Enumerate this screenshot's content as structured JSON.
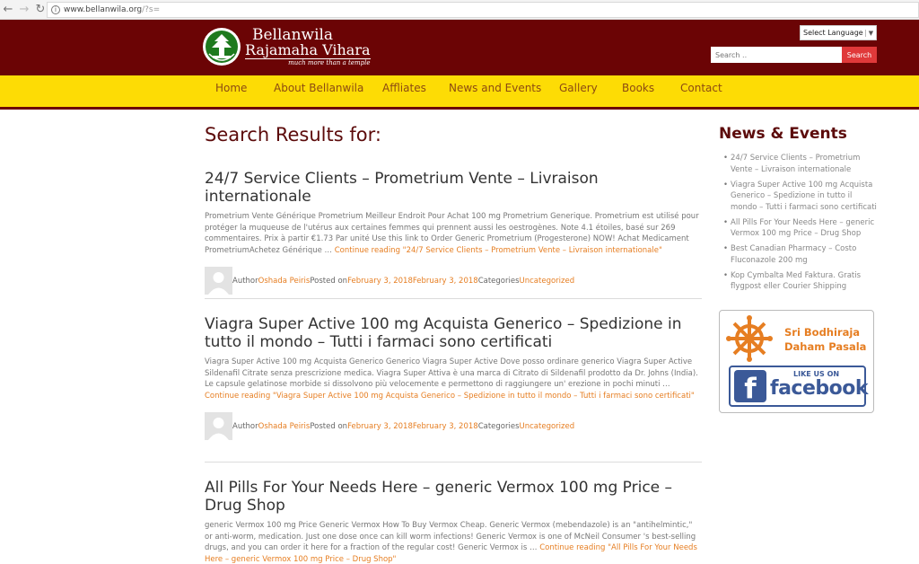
{
  "browser": {
    "url_host": "www.bellanwila.org",
    "url_path": "/?s="
  },
  "header": {
    "logo_line1": "Bellanwila",
    "logo_line2": "Rajamaha Vihara",
    "logo_tagline": "much more than a temple",
    "language_select": "Select Language",
    "search_placeholder": "Search ..",
    "search_button": "Search"
  },
  "nav": [
    {
      "label": "Home"
    },
    {
      "label": "About Bellanwila"
    },
    {
      "label": "Affliates"
    },
    {
      "label": "News and Events"
    },
    {
      "label": "Gallery"
    },
    {
      "label": "Books"
    },
    {
      "label": "Contact"
    }
  ],
  "main": {
    "results_title": "Search Results for:",
    "meta_labels": {
      "author": "Author ",
      "posted_on": "Posted on ",
      "categories": "Categories "
    },
    "posts": [
      {
        "title": "24/7 Service Clients – Prometrium Vente – Livraison internationale",
        "excerpt": "Prometrium Vente Générique Prometrium Meilleur Endroit Pour Achat 100 mg Prometrium Generique. Prometrium est utilisé pour protéger la muqueuse de l'utérus aux certaines femmes qui prennent aussi les oestrogènes. Note 4.1 étoiles, basé sur 269 commentaires. Prix à partir €1.73 Par unité Use this link to Order Generic Prometrium (Progesterone) NOW! Achat Medicament PrometriumAchetez Générique … ",
        "more": "Continue reading \"24/7 Service Clients – Prometrium Vente – Livraison internationale\"",
        "author": "Oshada Peiris",
        "date": "February 3, 2018February 3, 2018",
        "category": "Uncategorized"
      },
      {
        "title": "Viagra Super Active 100 mg Acquista Generico – Spedizione in tutto il mondo – Tutti i farmaci sono certificati",
        "excerpt": "Viagra Super Active 100 mg Acquista Generico Generico Viagra Super Active Dove posso ordinare generico Viagra Super Active Sildenafil Citrate senza prescrizione medica. Viagra Super Attiva è una marca di Citrato di Sildenafil prodotto da Dr. Johns (India). Le capsule gelatinose morbide si dissolvono più velocemente e permettono di raggiungere un' erezione in pochi minuti … ",
        "more": "Continue reading \"Viagra Super Active 100 mg Acquista Generico – Spedizione in tutto il mondo – Tutti i farmaci sono certificati\"",
        "author": "Oshada Peiris",
        "date": "February 3, 2018February 3, 2018",
        "category": "Uncategorized"
      },
      {
        "title": "All Pills For Your Needs Here – generic Vermox 100 mg Price – Drug Shop",
        "excerpt": "generic Vermox 100 mg Price Generic Vermox How To Buy Vermox Cheap. Generic Vermox (mebendazole) is an \"antihelmintic,\" or anti-worm, medication. Just one dose once can kill worm infections! Generic Vermox is one of McNeil Consumer 's best-selling drugs, and you can order it here for a fraction of the regular cost! Generic Vermox is … ",
        "more": "Continue reading \"All Pills For Your Needs Here – generic Vermox 100 mg Price – Drug Shop\""
      }
    ]
  },
  "sidebar": {
    "title": "News & Events",
    "items": [
      {
        "label": "24/7 Service Clients – Prometrium Vente – Livraison internationale"
      },
      {
        "label": "Viagra Super Active 100 mg Acquista Generico – Spedizione in tutto il mondo – Tutti i farmaci sono certificati"
      },
      {
        "label": "All Pills For Your Needs Here – generic Vermox 100 mg Price – Drug Shop"
      },
      {
        "label": "Best Canadian Pharmacy – Costo Fluconazole 200 mg"
      },
      {
        "label": "Kop Cymbalta Med Faktura. Gratis flygpost eller Courier Shipping"
      }
    ],
    "promo_line1": "Sri Bodhiraja",
    "promo_line2": "Daham Pasala",
    "fb_like": "LIKE US ON",
    "fb_word": "facebook"
  },
  "colors": {
    "header_bg": "#6b0405",
    "nav_bg": "#fddc05",
    "accent": "#e67e22",
    "search_button": "#e0393a"
  }
}
